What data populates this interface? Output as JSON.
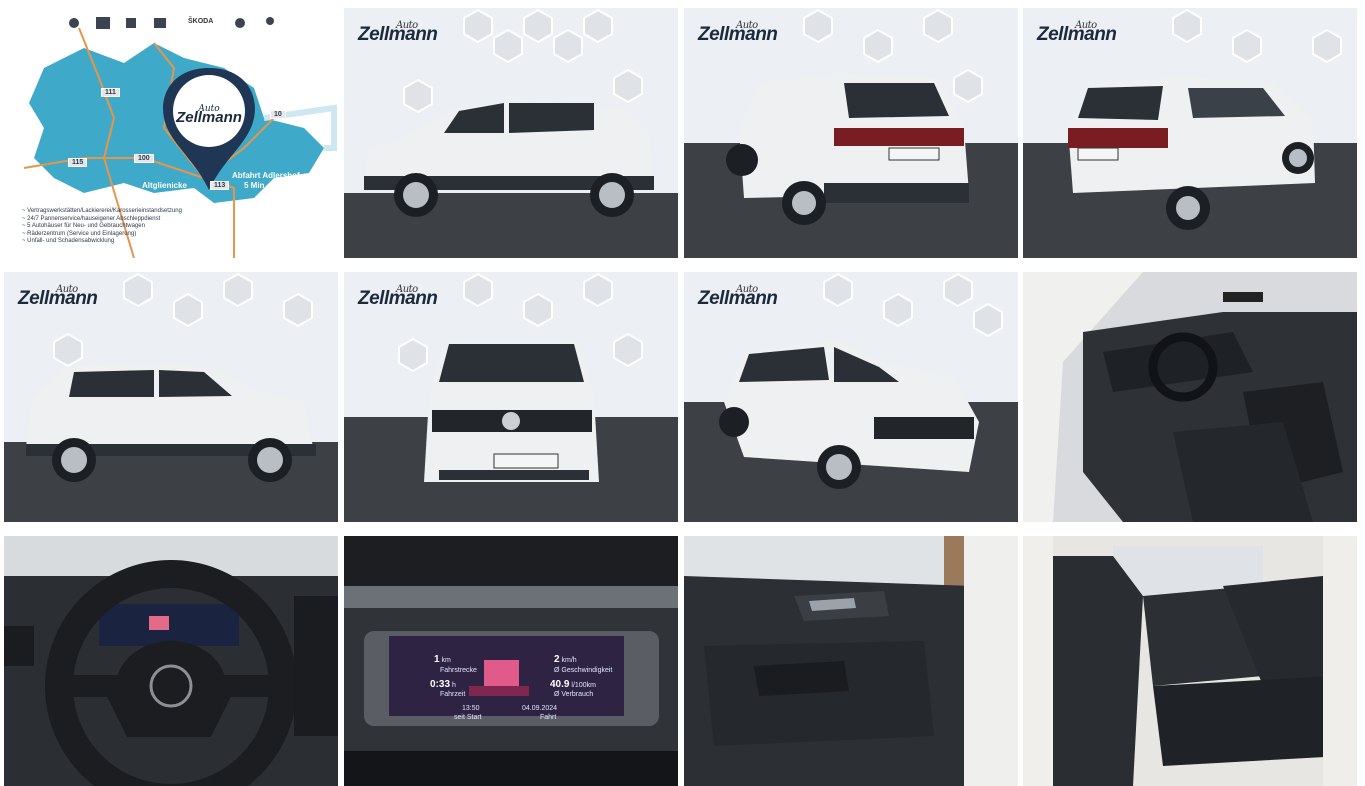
{
  "gallery": {
    "brand_logo": {
      "text": "Zellmann",
      "script": "Auto"
    },
    "map_panel": {
      "header_brands": [
        "ŠKODA"
      ],
      "pin_logo": {
        "text": "Zellmann",
        "script": "Auto"
      },
      "road_labels": [
        "111",
        "100",
        "115",
        "113",
        "10"
      ],
      "place_labels": [
        "Altglienicke",
        "Abfahrt Adlershof",
        "5 Min."
      ],
      "bullets": [
        "~ Vertragswerkstätten/Lackiererei/Karosserieinstandsetzung",
        "~ 24/7 Pannenservice/hauseigener Abschleppdienst",
        "~ 5 Autohäuser für Neu- und Gebrauchtwagen",
        "~ Räderzentrum (Service und Einlagerung)",
        "~ Unfall- und Schadensabwicklung"
      ]
    },
    "cluster": {
      "range_value": "1",
      "range_unit": "km",
      "range_label": "Fahrstrecke",
      "time_value": "0:33",
      "time_unit": "h",
      "time_label": "Fahrzeit",
      "speed_value": "2",
      "speed_unit": "km/h",
      "speed_label": "Ø Geschwindigkeit",
      "consumption_value": "40.9",
      "consumption_unit": "l/100km",
      "consumption_label": "Ø Verbrauch",
      "clock": "13:50",
      "date": "04.09.2024",
      "status_left": "seit Start",
      "status_right": "Fahrt"
    },
    "tiles": [
      "photo-dealer-map",
      "photo-side-right",
      "photo-rear-left",
      "photo-rear-right",
      "photo-side-left",
      "photo-front",
      "photo-front-left",
      "photo-interior-front",
      "photo-steering-wheel",
      "photo-instrument-cluster",
      "photo-door-panel",
      "photo-rear-seats"
    ],
    "colors": {
      "map_blue": "#3fa9c9",
      "road_orange": "#e8954a",
      "pin_navy": "#1f3654",
      "car_white": "#eef0f1",
      "floor_dark": "#3d4044",
      "wall_light": "#eceff3"
    }
  }
}
